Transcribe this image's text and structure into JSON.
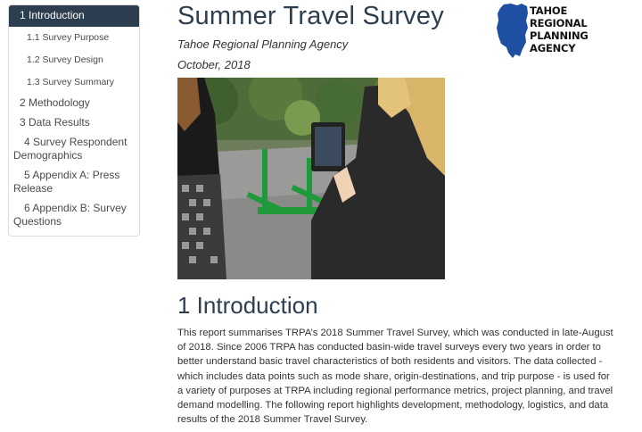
{
  "toc": {
    "items": [
      {
        "label": "1 Introduction",
        "active": true
      },
      {
        "label": "1.1 Survey Purpose"
      },
      {
        "label": "1.2 Survey Design"
      },
      {
        "label": "1.3 Survey Summary"
      },
      {
        "label": "2 Methodology"
      },
      {
        "label": "3 Data Results"
      },
      {
        "label": "4 Survey Respondent Demographics"
      },
      {
        "label": "5 Appendix A: Press Release"
      },
      {
        "label": "6 Appendix B: Survey Questions"
      }
    ]
  },
  "header": {
    "title": "Summer Travel Survey",
    "author": "Tahoe Regional Planning Agency",
    "date": "October, 2018"
  },
  "logo": {
    "lines": [
      "TAHOE",
      "REGIONAL",
      "PLANNING",
      "AGENCY"
    ],
    "color": "#1f4fa3"
  },
  "section": {
    "heading": "1 Introduction",
    "paragraph": "This report summarises TRPA’s 2018 Summer Travel Survey, which was conducted in late-August of 2018. Since 2006 TRPA has conducted basin-wide travel surveys every two years in order to better understand basic travel characteristics of both residents and visitors. The data collected - which includes data points such as mode share, origin-destinations, and trip purpose - is used for a variety of purposes at TRPA including regional performance metrics, project planning, and travel demand modelling. The following report highlights development, methodology, logistics, and data results of the 2018 Summer Travel Survey."
  },
  "colors": {
    "accent": "#2c3e50",
    "link": "#4a4a4a"
  }
}
